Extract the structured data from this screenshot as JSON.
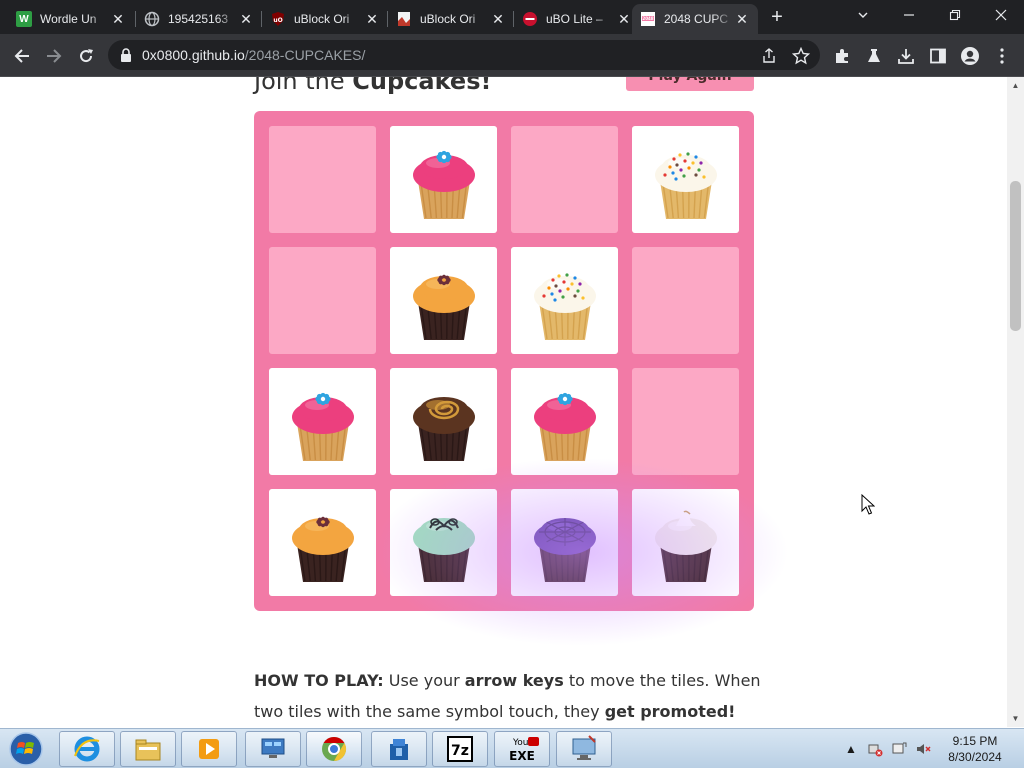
{
  "browser": {
    "tabs": [
      {
        "title": "Wordle Un",
        "icon": "wordle-w-icon",
        "favicon_text": "W",
        "color": "#2e9e44"
      },
      {
        "title": "195425163",
        "icon": "globe-icon",
        "favicon_text": "",
        "color": "#9aa0a6"
      },
      {
        "title": "uBlock Ori",
        "icon": "ublock-icon",
        "favicon_text": "",
        "color": "#800000"
      },
      {
        "title": "uBlock Ori",
        "icon": "github-doc-icon",
        "favicon_text": "",
        "color": "#d0d0d0"
      },
      {
        "title": "uBO Lite –",
        "icon": "ubo-lite-icon",
        "favicon_text": "",
        "color": "#c8102e"
      },
      {
        "title": "2048 CUPC",
        "icon": "cupcake-favicon-icon",
        "favicon_text": "",
        "color": "#f27aa6"
      }
    ],
    "active_tab_index": 5,
    "url_host": "0x0800.github.io",
    "url_path": "/2048-CUPCAKES/"
  },
  "page": {
    "heading_prefix": "Join the",
    "heading_strong": "Cupcakes!",
    "play_again_label": "Play Again",
    "board": [
      [
        null,
        "pink-frosting-cupcake",
        null,
        "sprinkle-vanilla-cupcake"
      ],
      [
        null,
        "orange-chocolate-cupcake",
        "sprinkle-vanilla-cupcake",
        null
      ],
      [
        "pink-frosting-cupcake",
        "chocolate-swirl-cupcake",
        "pink-frosting-cupcake",
        null
      ],
      [
        "orange-chocolate-cupcake",
        "mint-chocolate-cupcake",
        "purple-web-cupcake",
        "white-meringue-cupcake"
      ]
    ],
    "howto": {
      "label": "HOW TO PLAY:",
      "t1": " Use your ",
      "b1": "arrow keys",
      "t2": " to move the tiles. When two tiles with the same symbol touch, they ",
      "b2": "get promoted!"
    }
  },
  "taskbar": {
    "apps": [
      "internet-explorer-icon",
      "file-explorer-icon",
      "media-player-icon",
      "remote-desktop-icon",
      "chrome-icon",
      "dropbox-icon",
      "7zip-icon",
      "youtube-exe-icon",
      "computer-icon"
    ],
    "app_labels": {
      "7zip": "7z",
      "youtube_top": "You",
      "youtube_bottom": "EXE"
    },
    "time": "9:15 PM",
    "date": "8/30/2024"
  },
  "colors": {
    "board": "#f27aa6",
    "empty_cell": "#fca8c5",
    "play_button": "#f78fb1",
    "chrome_dark": "#202124",
    "chrome_toolbar": "#35363a"
  }
}
